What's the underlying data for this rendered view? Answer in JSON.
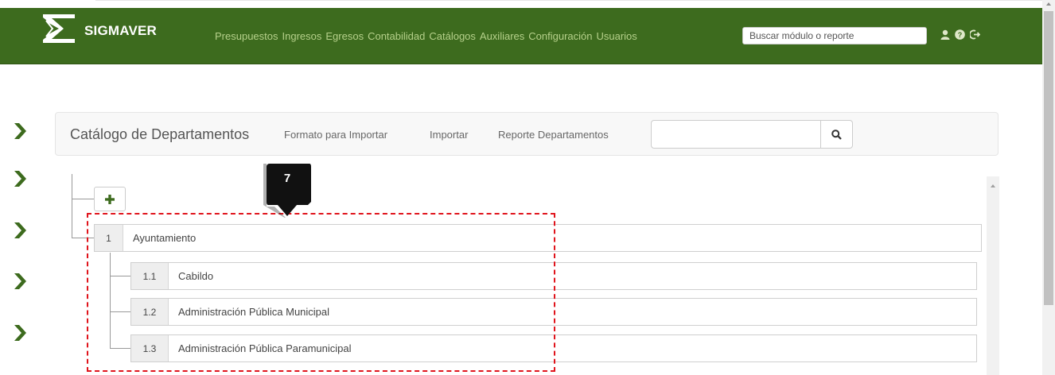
{
  "brand": {
    "name": "SIGMAVER",
    "logo_icon": "sigma-logo-icon"
  },
  "nav": {
    "menu": [
      "Presupuestos",
      "Ingresos",
      "Egresos",
      "Contabilidad",
      "Catálogos",
      "Auxiliares",
      "Configuración",
      "Usuarios"
    ],
    "search_placeholder": "Buscar módulo o reporte",
    "icons": [
      "user-icon",
      "help-icon",
      "logout-icon"
    ]
  },
  "catalog": {
    "title": "Catálogo de Departamentos",
    "links": [
      "Formato para Importar",
      "Importar",
      "Reporte Departamentos"
    ],
    "search_value": "",
    "search_icon": "search-icon"
  },
  "tree": {
    "add_icon": "plus-icon",
    "root": {
      "num": "1",
      "label": "Ayuntamiento"
    },
    "children": [
      {
        "num": "1.1",
        "label": "Cabildo"
      },
      {
        "num": "1.2",
        "label": "Administración Pública Municipal"
      },
      {
        "num": "1.3",
        "label": "Administración Pública Paramunicipal"
      }
    ]
  },
  "annotation": {
    "number": "7"
  },
  "colors": {
    "navbar": "#3d6b1e",
    "menu_text": "#b5d08a",
    "accent_green": "#3d6b1e",
    "annotation_border": "#e0141c"
  }
}
